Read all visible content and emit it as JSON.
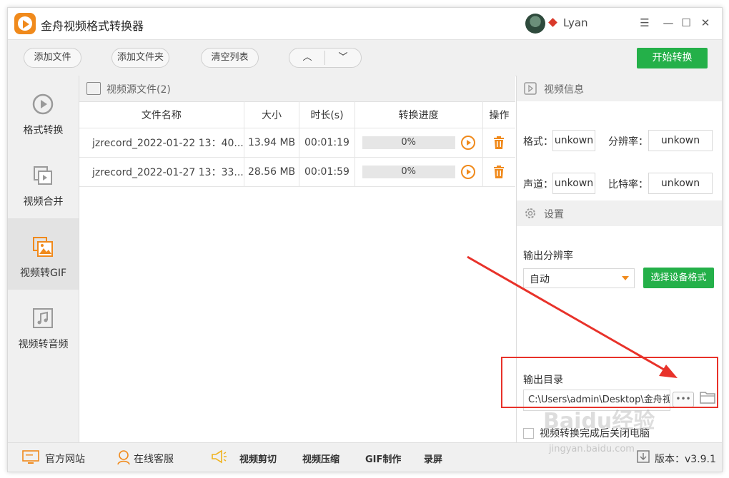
{
  "app": {
    "title": "金舟视频格式转换器",
    "user": "Lyan",
    "window_controls": [
      "☰",
      "—",
      "☐",
      "✕"
    ]
  },
  "toolbar": {
    "add_file": "添加文件",
    "add_folder": "添加文件夹",
    "clear_list": "清空列表",
    "move_up": "︿",
    "move_down": "﹀",
    "start": "开始转换"
  },
  "sidebar": {
    "items": [
      {
        "label": "格式转换",
        "icon": "format-convert-icon"
      },
      {
        "label": "视频合并",
        "icon": "video-merge-icon"
      },
      {
        "label": "视频转GIF",
        "icon": "video-to-gif-icon",
        "active": true
      },
      {
        "label": "视频转音频",
        "icon": "video-to-audio-icon"
      }
    ]
  },
  "file_panel": {
    "title": "视频源文件(2)",
    "columns": [
      "文件名称",
      "大小",
      "时长(s)",
      "转换进度",
      "操作"
    ],
    "rows": [
      {
        "name": "jzrecord_2022-01-22 13：40...",
        "size": "13.94 MB",
        "duration": "00:01:19",
        "progress": "0%",
        "progress_value": 0
      },
      {
        "name": "jzrecord_2022-01-27 13：33...",
        "size": "28.56 MB",
        "duration": "00:01:59",
        "progress": "0%",
        "progress_value": 0
      }
    ]
  },
  "video_info": {
    "title": "视频信息",
    "format_label": "格式：",
    "format_value": "unkown",
    "resolution_label": "分辨率：",
    "resolution_value": "unkown",
    "channel_label": "声道：",
    "channel_value": "unkown",
    "bitrate_label": "比特率：",
    "bitrate_value": "unkown"
  },
  "settings": {
    "title": "设置",
    "output_resolution_label": "输出分辨率",
    "output_resolution_value": "自动",
    "select_device_button": "选择设备格式",
    "output_dir_label": "输出目录",
    "output_dir_value": "C:\\Users\\admin\\Desktop\\金舟视",
    "browse_button": "•••",
    "shutdown_label": "视频转换完成后关闭电脑"
  },
  "bottombar": {
    "website": "官方网站",
    "support": "在线客服",
    "video_cut": "视频剪切",
    "video_compress": "视频压缩",
    "gif_make": "GIF制作",
    "record": "录屏",
    "version": "版本：v3.9.1"
  },
  "watermark": {
    "brand": "Baidu经验",
    "site": "jingyan.baidu.com"
  },
  "colors": {
    "accent_orange": "#f08a1c",
    "primary_green": "#24b049",
    "annotation_red": "#e8322a"
  }
}
